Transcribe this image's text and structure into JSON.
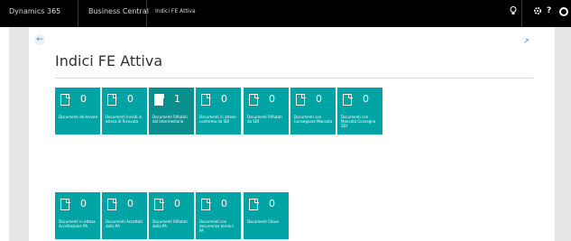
{
  "topbar": {
    "brand": "Dynamics 365",
    "app": "Business Central",
    "page": "Indici FE Attiva",
    "icons": [
      "lightbulb-icon",
      "settings-icon",
      "help-icon",
      "user-avatar"
    ],
    "help_label": "?"
  },
  "page": {
    "title": "Indici FE Attiva",
    "back_icon": "arrow-left-icon",
    "expand_icon": "expand-icon",
    "accent": "#00a4a4"
  },
  "tiles_row1": [
    {
      "count": "0",
      "caption": "Documenti da Inviare"
    },
    {
      "count": "0",
      "caption": "Documenti Inviati in attesa di Ricevuta"
    },
    {
      "count": "1",
      "caption": "Documenti Rifiutati dal Intermediario"
    },
    {
      "count": "0",
      "caption": "Documenti in attesa conferma da SDI"
    },
    {
      "count": "0",
      "caption": "Documenti Rifiutati da SDI"
    },
    {
      "count": "0",
      "caption": "Documenti con Consegnare Mancata"
    },
    {
      "count": "0",
      "caption": "Documenti con Mancata Consegna SDI"
    }
  ],
  "tiles_row2": [
    {
      "count": "0",
      "caption": "Documenti in attesa Accettazione PA"
    },
    {
      "count": "0",
      "caption": "Documenti Accettati dalla PA"
    },
    {
      "count": "0",
      "caption": "Documenti Rifiutati dalla PA"
    },
    {
      "count": "0",
      "caption": "Documenti con decorrenza termini PA"
    },
    {
      "count": "0",
      "caption": "Documenti Chiusi"
    }
  ]
}
